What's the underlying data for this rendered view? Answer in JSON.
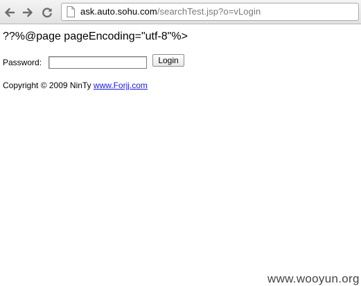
{
  "browser": {
    "url_host": "ask.auto.sohu.com",
    "url_path": "/searchTest.jsp?o=vLogin",
    "icons": [
      "back-arrow-icon",
      "forward-arrow-icon",
      "reload-icon",
      "page-icon"
    ]
  },
  "page": {
    "jsp_text": "??%@page pageEncoding=\"utf-8\"%>",
    "password_label": "Password:",
    "password_value": "",
    "login_label": "Login",
    "copyright_prefix": "Copyright © 2009 NinTy",
    "copyright_link": "www.Forjj.com"
  },
  "watermark": "www.wooyun.org",
  "colors": {
    "link": "#1a1ae6",
    "url_path": "#7a7a7a"
  }
}
